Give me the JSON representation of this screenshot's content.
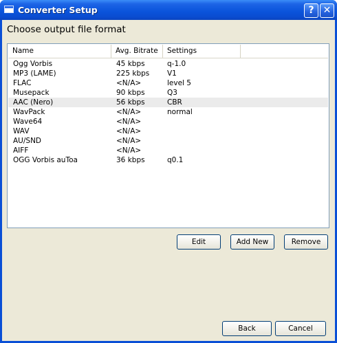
{
  "window": {
    "title": "Converter Setup",
    "help_glyph": "?",
    "close_glyph": "✕"
  },
  "heading": "Choose output file format",
  "list": {
    "columns": [
      "Name",
      "Avg. Bitrate",
      "Settings"
    ],
    "rows": [
      {
        "name": "Ogg Vorbis",
        "bitrate": "45 kbps",
        "settings": "q-1.0"
      },
      {
        "name": "MP3 (LAME)",
        "bitrate": "225 kbps",
        "settings": "V1"
      },
      {
        "name": "FLAC",
        "bitrate": "<N/A>",
        "settings": "level 5"
      },
      {
        "name": "Musepack",
        "bitrate": "90 kbps",
        "settings": "Q3"
      },
      {
        "name": "AAC (Nero)",
        "bitrate": "56 kbps",
        "settings": "CBR",
        "selected": true
      },
      {
        "name": "WavPack",
        "bitrate": "<N/A>",
        "settings": "normal"
      },
      {
        "name": "Wave64",
        "bitrate": "<N/A>",
        "settings": ""
      },
      {
        "name": "WAV",
        "bitrate": "<N/A>",
        "settings": ""
      },
      {
        "name": "AU/SND",
        "bitrate": "<N/A>",
        "settings": ""
      },
      {
        "name": "AIFF",
        "bitrate": "<N/A>",
        "settings": ""
      },
      {
        "name": "OGG Vorbis auToa",
        "bitrate": "36 kbps",
        "settings": "q0.1"
      }
    ]
  },
  "buttons": {
    "edit": "Edit",
    "add_new": "Add New",
    "remove": "Remove",
    "back": "Back",
    "cancel": "Cancel"
  },
  "icons": {
    "window_icon": "window-icon",
    "help": "help-icon",
    "close": "close-icon"
  },
  "colors": {
    "titlebar": "#0b55dc",
    "client_bg": "#ece9d8",
    "list_border": "#7f9db9",
    "selected_row": "#ebebeb"
  }
}
